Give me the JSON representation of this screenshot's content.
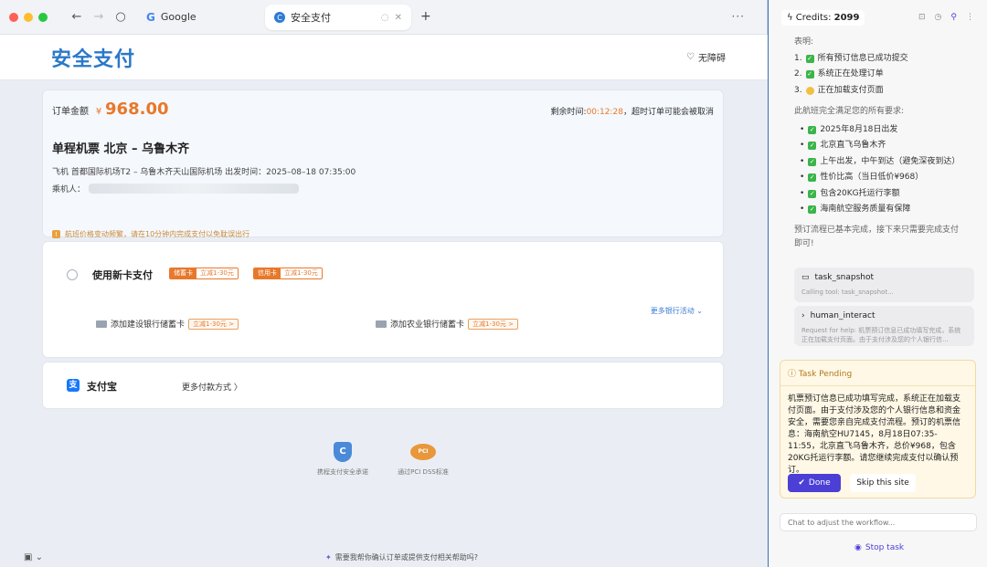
{
  "browser": {
    "tabs": [
      {
        "label": "Google"
      },
      {
        "label": "安全支付"
      }
    ],
    "nav": {
      "back": "←",
      "forward": "→",
      "reload": "○"
    },
    "new_tab": "+",
    "more": "···"
  },
  "page": {
    "title": "安全支付",
    "accessibility": "无障碍",
    "order": {
      "amount_label": "订单金额",
      "currency": "¥",
      "amount": "968.00",
      "remaining_label": "剩余时间:",
      "remaining_time": "00:12:28",
      "remaining_suffix": "，超时订单可能会被取消",
      "flight_title": "单程机票 北京 – 乌鲁木齐",
      "flight_detail": "飞机 首都国际机场T2 – 乌鲁木齐天山国际机场 出发时间：2025–08–18 07:35:00",
      "passenger_label": "乘机人：",
      "notice": "航班价格变动频繁，请在10分钟内完成支付以免耽误出行"
    },
    "new_card": {
      "title": "使用新卡支付",
      "tags": [
        {
          "kind": "储蓄卡",
          "promo": "立减1-30元"
        },
        {
          "kind": "信用卡",
          "promo": "立减1-30元"
        }
      ],
      "more_banks": "更多银行活动 ⌄",
      "banks": [
        {
          "label": "添加建设银行储蓄卡",
          "promo": "立减1-30元 >"
        },
        {
          "label": "添加农业银行储蓄卡",
          "promo": "立减1-30元 >"
        }
      ]
    },
    "alipay": {
      "icon": "支",
      "label": "支付宝",
      "more": "更多付款方式 〉"
    },
    "badges": [
      {
        "icon": "C",
        "label": "携程支付安全承诺"
      },
      {
        "icon": "PCI",
        "label": "通过PCI DSS标准"
      }
    ],
    "bottom_hint": "需要我帮你确认订单或提供支付相关帮助吗?"
  },
  "side": {
    "credits_label": "Credits:",
    "credits_value": "2099",
    "intro": "表明:",
    "status_items": [
      {
        "n": "1.",
        "icon": "check",
        "text": "所有预订信息已成功提交"
      },
      {
        "n": "2.",
        "icon": "check",
        "text": "系统正在处理订单"
      },
      {
        "n": "3.",
        "icon": "wait",
        "text": "正在加载支付页面"
      }
    ],
    "req_title": "此航班完全满足您的所有要求:",
    "requirements": [
      "2025年8月18日出发",
      "北京直飞乌鲁木齐",
      "上午出发，中午到达（避免深夜到达）",
      "性价比高（当日低价¥968）",
      "包含20KG托运行李额",
      "海南航空服务质量有保障"
    ],
    "summary": "预订流程已基本完成，接下来只需要完成支付即可!",
    "tools": [
      {
        "name": "task_snapshot",
        "sub": "Calling tool: task_snapshot..."
      },
      {
        "name": "human_interact",
        "sub": "Request for help: 机票预订信息已成功填写完成，系统正在加载支付页面。由于支付涉及您的个人银行信..."
      }
    ],
    "pending": {
      "title": "Task Pending",
      "body": "机票预订信息已成功填写完成，系统正在加载支付页面。由于支付涉及您的个人银行信息和资金安全，需要您亲自完成支付流程。预订的机票信息：海南航空HU7145，8月18日07:35-11:55，北京直飞乌鲁木齐，总价¥968，包含20KG托运行李额。请您继续完成支付以确认预订。",
      "done": "Done",
      "skip": "Skip this site"
    },
    "chat_placeholder": "Chat to adjust the workflow...",
    "stop": "Stop task"
  }
}
